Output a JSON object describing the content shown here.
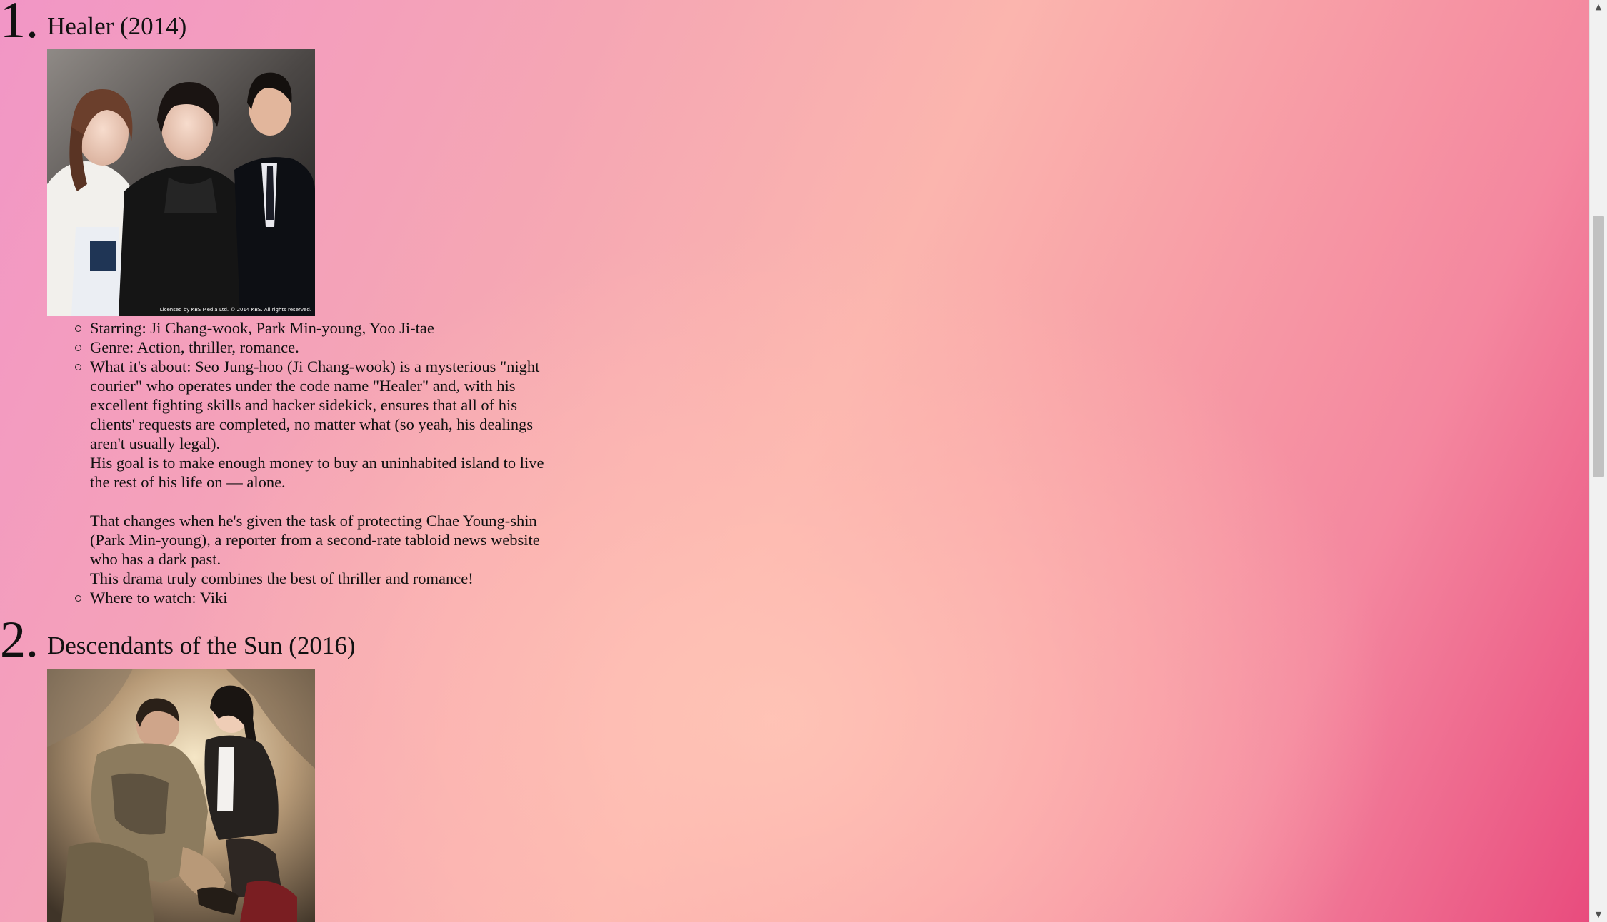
{
  "entries": [
    {
      "number": "1.",
      "title": "Healer (2014)",
      "poster_caption": "Licensed by KBS Media Ltd. © 2014 KBS. All rights reserved.",
      "details": {
        "starring": "Starring: Ji Chang-wook, Park Min-young, Yoo Ji-tae",
        "genre": "Genre: Action, thriller, romance.",
        "about_1": "What it's about: Seo Jung-hoo (Ji Chang-wook) is a mysterious \"night courier\" who operates under the code name \"Healer\" and, with his excellent fighting skills and hacker sidekick, ensures that all of his clients' requests are completed, no matter what (so yeah, his dealings aren't usually legal).",
        "about_2": "His goal is to make enough money to buy an uninhabited island to live the rest of his life on — alone.",
        "about_3": "That changes when he's given the task of protecting Chae Young-shin (Park Min-young), a reporter from a second-rate tabloid news website who has a dark past.",
        "about_4": "This drama truly combines the best of thriller and romance!",
        "watch": "Where to watch: Viki"
      }
    },
    {
      "number": "2.",
      "title": "Descendants of the Sun (2016)"
    }
  ],
  "scrollbar": {
    "up_arrow": "▲",
    "down_arrow": "▼"
  }
}
